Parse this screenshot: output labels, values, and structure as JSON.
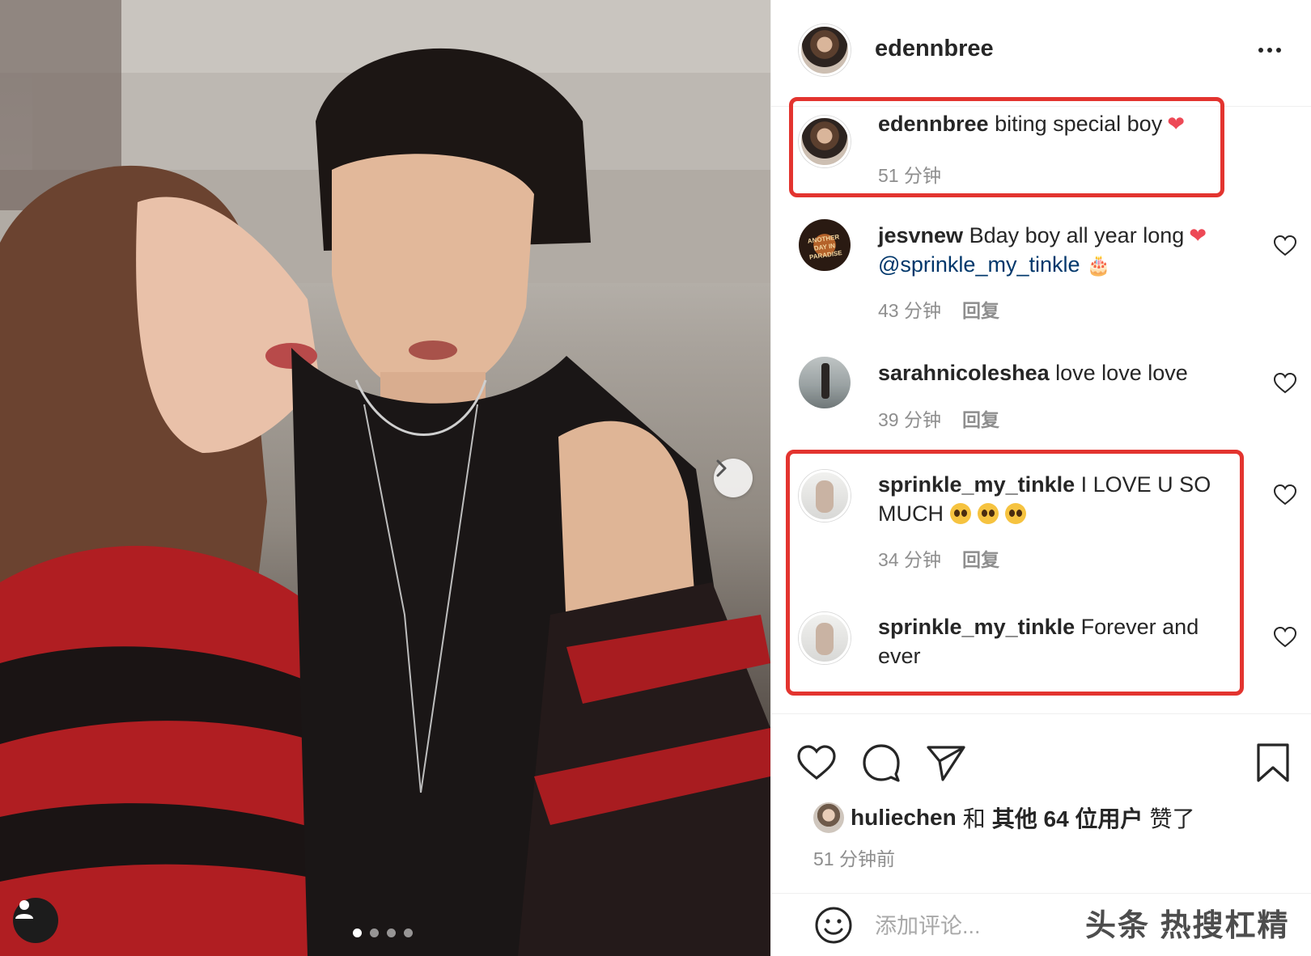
{
  "post": {
    "username": "edennbree",
    "carousel": {
      "total": 4,
      "active": 1
    }
  },
  "comments": [
    {
      "user": "edennbree",
      "text": "biting special boy",
      "time": "51 分钟",
      "reply": ""
    },
    {
      "user": "jesvnew",
      "text": "Bday boy all year long",
      "mention": "@sprinkle_my_tinkle",
      "time": "43 分钟",
      "reply": "回复",
      "avatar_text": "ANOTHER DAY IN PARADISE"
    },
    {
      "user": "sarahnicoleshea",
      "text": "love love love",
      "time": "39 分钟",
      "reply": "回复"
    },
    {
      "user": "sprinkle_my_tinkle",
      "text": "I LOVE U SO MUCH",
      "time": "34 分钟",
      "reply": "回复"
    },
    {
      "user": "sprinkle_my_tinkle",
      "text": "Forever and ever",
      "time": "",
      "reply": ""
    }
  ],
  "likes": {
    "user": "huliechen",
    "connector": "和",
    "others": "其他 64 位用户",
    "suffix": "赞了"
  },
  "posted_ago": "51 分钟前",
  "add_comment": {
    "placeholder": "添加评论..."
  },
  "watermark": "头条 热搜杠精",
  "colors": {
    "highlight": "#e3342f",
    "heart": "#ed4956",
    "mention": "#00376b",
    "meta": "#8e8e8e"
  }
}
